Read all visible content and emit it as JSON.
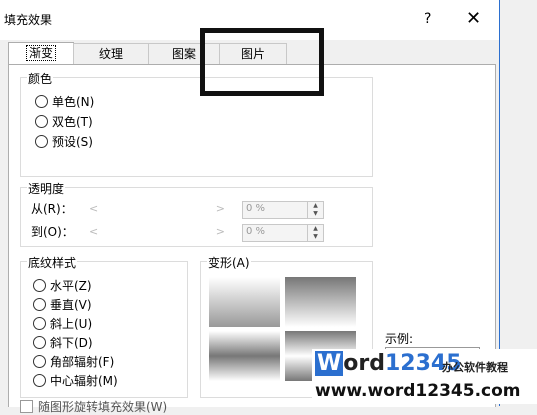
{
  "dialog": {
    "title": "填充效果",
    "help_label": "?",
    "close_label": "✕"
  },
  "tabs": [
    {
      "label": "渐变"
    },
    {
      "label": "纹理"
    },
    {
      "label": "图案"
    },
    {
      "label": "图片"
    }
  ],
  "colors": {
    "legend": "颜色",
    "opt1": "单色(N)",
    "opt2": "双色(T)",
    "opt3": "预设(S)"
  },
  "transparency": {
    "legend": "透明度",
    "from_label": "从(R)：",
    "to_label": "到(O)：",
    "from_value": "0 %",
    "to_value": "0 %"
  },
  "shading": {
    "legend": "底纹样式",
    "opt1": "水平(Z)",
    "opt2": "垂直(V)",
    "opt3": "斜上(U)",
    "opt4": "斜下(D)",
    "opt5": "角部辐射(F)",
    "opt6": "中心辐射(M)"
  },
  "variants": {
    "legend": "变形(A)"
  },
  "sample": {
    "label": "示例:"
  },
  "rotate_checkbox": {
    "label": "随图形旋转填充效果(W)"
  },
  "watermark": {
    "brand_w": "W",
    "brand_ord": "ord",
    "brand_num": "12345",
    "brand_tag": "办公软件教程",
    "url": "www.word12345.com"
  },
  "accent": "#2b6fcf"
}
